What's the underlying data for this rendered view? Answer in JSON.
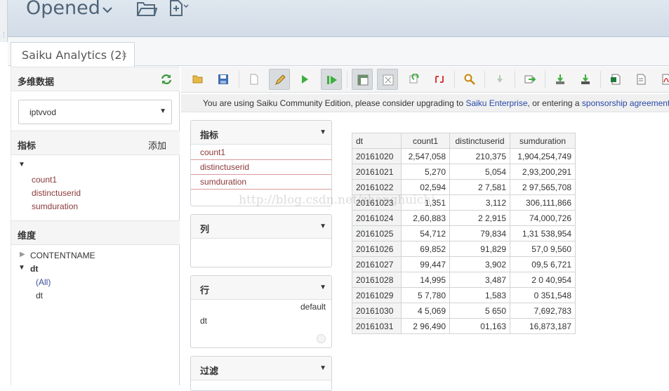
{
  "header": {
    "title": "Opened"
  },
  "tab": {
    "label": "Saiku Analytics (2)",
    "close": "×"
  },
  "sidebar": {
    "cube_title": "多维数据",
    "cube_selected": "iptvvod",
    "measures_title": "指标",
    "add_label": "添加",
    "measures": [
      "count1",
      "distinctuserid",
      "sumduration"
    ],
    "dimensions_title": "维度",
    "dimensions": {
      "contentname": "CONTENTNAME",
      "dt": "dt",
      "dt_all": "(All)",
      "dt_level": "dt"
    }
  },
  "notice": {
    "prefix": "You are using Saiku Community Edition, please consider upgrading to ",
    "link1": "Saiku Enterprise",
    "middle": ", or entering a ",
    "link2": "sponsorship agreement"
  },
  "zones": {
    "measures": {
      "title": "指标",
      "items": [
        "count1",
        "distinctuserid",
        "sumduration"
      ]
    },
    "columns": {
      "title": "列"
    },
    "rows": {
      "title": "行",
      "default_label": "default",
      "item": "dt"
    },
    "filter": {
      "title": "过滤"
    }
  },
  "watermark": "http://blog.csdn.net/zhanghuichi",
  "table": {
    "headers": [
      "dt",
      "count1",
      "distinctuserid",
      "sumduration"
    ],
    "rows": [
      [
        "20161020",
        "2,547,058",
        "210,375",
        "1,904,254,749"
      ],
      [
        "20161021",
        "5,270",
        "5,054",
        "2,93,200,291"
      ],
      [
        "20161022",
        "02,594",
        "2 7,581",
        "2 97,565,708"
      ],
      [
        "20161023",
        "1,351",
        "3,112",
        "306,111,866"
      ],
      [
        "20161024",
        "2,60,883",
        "2 2,915",
        "74,000,726"
      ],
      [
        "20161025",
        "54,712",
        "79,834",
        "1,31 538,954"
      ],
      [
        "20161026",
        "69,852",
        "91,829",
        "57,0 9,560"
      ],
      [
        "20161027",
        "99,447",
        "3,902",
        "09,5 6,721"
      ],
      [
        "20161028",
        "14,995",
        "3,487",
        "2 0 40,954"
      ],
      [
        "20161029",
        "5 7,780",
        "1,583",
        "0 351,548"
      ],
      [
        "20161030",
        "4 5,069",
        "5 650",
        "7,692,783"
      ],
      [
        "20161031",
        "2 96,490",
        "01,163",
        "16,873,187"
      ]
    ]
  },
  "icons": [
    "open-folder-icon",
    "save-icon",
    "new-query-icon",
    "edit-icon",
    "run-icon",
    "auto-run-icon",
    "toggle-fields-icon",
    "hide-parents-icon",
    "refresh-icon",
    "swap-axes-icon",
    "zoom-icon",
    "drill-down-icon",
    "drill-across-icon",
    "export-xls-icon",
    "export-csv-icon",
    "export-pdf-icon"
  ]
}
